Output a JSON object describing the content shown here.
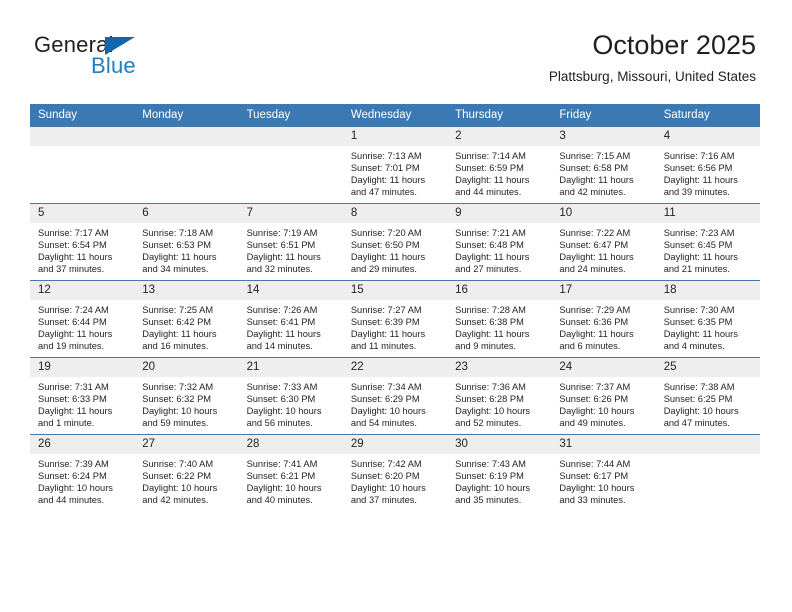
{
  "brand": {
    "name_top": "General",
    "name_bottom": "Blue",
    "color_dark": "#231f20",
    "color_blue": "#1f7fc4",
    "triangle_color": "#1266ae"
  },
  "header": {
    "title": "October 2025",
    "subtitle": "Plattsburg, Missouri, United States"
  },
  "theme": {
    "header_blue": "#3b79b5",
    "row_rule": "#4a77a8",
    "daynum_band": "#eeeeee",
    "text": "#231f20"
  },
  "labels": {
    "sunrise": "Sunrise:",
    "sunset": "Sunset:",
    "daylight": "Daylight:"
  },
  "weekdays": [
    "Sunday",
    "Monday",
    "Tuesday",
    "Wednesday",
    "Thursday",
    "Friday",
    "Saturday"
  ],
  "weeks": [
    [
      {
        "day": "",
        "blank": true,
        "sunrise": "",
        "sunset": "",
        "daylight": ""
      },
      {
        "day": "",
        "blank": true,
        "sunrise": "",
        "sunset": "",
        "daylight": ""
      },
      {
        "day": "",
        "blank": true,
        "sunrise": "",
        "sunset": "",
        "daylight": ""
      },
      {
        "day": "1",
        "blank": false,
        "sunrise": "Sunrise: 7:13 AM",
        "sunset": "Sunset: 7:01 PM",
        "daylight": "Daylight: 11 hours and 47 minutes."
      },
      {
        "day": "2",
        "blank": false,
        "sunrise": "Sunrise: 7:14 AM",
        "sunset": "Sunset: 6:59 PM",
        "daylight": "Daylight: 11 hours and 44 minutes."
      },
      {
        "day": "3",
        "blank": false,
        "sunrise": "Sunrise: 7:15 AM",
        "sunset": "Sunset: 6:58 PM",
        "daylight": "Daylight: 11 hours and 42 minutes."
      },
      {
        "day": "4",
        "blank": false,
        "sunrise": "Sunrise: 7:16 AM",
        "sunset": "Sunset: 6:56 PM",
        "daylight": "Daylight: 11 hours and 39 minutes."
      }
    ],
    [
      {
        "day": "5",
        "blank": false,
        "sunrise": "Sunrise: 7:17 AM",
        "sunset": "Sunset: 6:54 PM",
        "daylight": "Daylight: 11 hours and 37 minutes."
      },
      {
        "day": "6",
        "blank": false,
        "sunrise": "Sunrise: 7:18 AM",
        "sunset": "Sunset: 6:53 PM",
        "daylight": "Daylight: 11 hours and 34 minutes."
      },
      {
        "day": "7",
        "blank": false,
        "sunrise": "Sunrise: 7:19 AM",
        "sunset": "Sunset: 6:51 PM",
        "daylight": "Daylight: 11 hours and 32 minutes."
      },
      {
        "day": "8",
        "blank": false,
        "sunrise": "Sunrise: 7:20 AM",
        "sunset": "Sunset: 6:50 PM",
        "daylight": "Daylight: 11 hours and 29 minutes."
      },
      {
        "day": "9",
        "blank": false,
        "sunrise": "Sunrise: 7:21 AM",
        "sunset": "Sunset: 6:48 PM",
        "daylight": "Daylight: 11 hours and 27 minutes."
      },
      {
        "day": "10",
        "blank": false,
        "sunrise": "Sunrise: 7:22 AM",
        "sunset": "Sunset: 6:47 PM",
        "daylight": "Daylight: 11 hours and 24 minutes."
      },
      {
        "day": "11",
        "blank": false,
        "sunrise": "Sunrise: 7:23 AM",
        "sunset": "Sunset: 6:45 PM",
        "daylight": "Daylight: 11 hours and 21 minutes."
      }
    ],
    [
      {
        "day": "12",
        "blank": false,
        "sunrise": "Sunrise: 7:24 AM",
        "sunset": "Sunset: 6:44 PM",
        "daylight": "Daylight: 11 hours and 19 minutes."
      },
      {
        "day": "13",
        "blank": false,
        "sunrise": "Sunrise: 7:25 AM",
        "sunset": "Sunset: 6:42 PM",
        "daylight": "Daylight: 11 hours and 16 minutes."
      },
      {
        "day": "14",
        "blank": false,
        "sunrise": "Sunrise: 7:26 AM",
        "sunset": "Sunset: 6:41 PM",
        "daylight": "Daylight: 11 hours and 14 minutes."
      },
      {
        "day": "15",
        "blank": false,
        "sunrise": "Sunrise: 7:27 AM",
        "sunset": "Sunset: 6:39 PM",
        "daylight": "Daylight: 11 hours and 11 minutes."
      },
      {
        "day": "16",
        "blank": false,
        "sunrise": "Sunrise: 7:28 AM",
        "sunset": "Sunset: 6:38 PM",
        "daylight": "Daylight: 11 hours and 9 minutes."
      },
      {
        "day": "17",
        "blank": false,
        "sunrise": "Sunrise: 7:29 AM",
        "sunset": "Sunset: 6:36 PM",
        "daylight": "Daylight: 11 hours and 6 minutes."
      },
      {
        "day": "18",
        "blank": false,
        "sunrise": "Sunrise: 7:30 AM",
        "sunset": "Sunset: 6:35 PM",
        "daylight": "Daylight: 11 hours and 4 minutes."
      }
    ],
    [
      {
        "day": "19",
        "blank": false,
        "sunrise": "Sunrise: 7:31 AM",
        "sunset": "Sunset: 6:33 PM",
        "daylight": "Daylight: 11 hours and 1 minute."
      },
      {
        "day": "20",
        "blank": false,
        "sunrise": "Sunrise: 7:32 AM",
        "sunset": "Sunset: 6:32 PM",
        "daylight": "Daylight: 10 hours and 59 minutes."
      },
      {
        "day": "21",
        "blank": false,
        "sunrise": "Sunrise: 7:33 AM",
        "sunset": "Sunset: 6:30 PM",
        "daylight": "Daylight: 10 hours and 56 minutes."
      },
      {
        "day": "22",
        "blank": false,
        "sunrise": "Sunrise: 7:34 AM",
        "sunset": "Sunset: 6:29 PM",
        "daylight": "Daylight: 10 hours and 54 minutes."
      },
      {
        "day": "23",
        "blank": false,
        "sunrise": "Sunrise: 7:36 AM",
        "sunset": "Sunset: 6:28 PM",
        "daylight": "Daylight: 10 hours and 52 minutes."
      },
      {
        "day": "24",
        "blank": false,
        "sunrise": "Sunrise: 7:37 AM",
        "sunset": "Sunset: 6:26 PM",
        "daylight": "Daylight: 10 hours and 49 minutes."
      },
      {
        "day": "25",
        "blank": false,
        "sunrise": "Sunrise: 7:38 AM",
        "sunset": "Sunset: 6:25 PM",
        "daylight": "Daylight: 10 hours and 47 minutes."
      }
    ],
    [
      {
        "day": "26",
        "blank": false,
        "sunrise": "Sunrise: 7:39 AM",
        "sunset": "Sunset: 6:24 PM",
        "daylight": "Daylight: 10 hours and 44 minutes."
      },
      {
        "day": "27",
        "blank": false,
        "sunrise": "Sunrise: 7:40 AM",
        "sunset": "Sunset: 6:22 PM",
        "daylight": "Daylight: 10 hours and 42 minutes."
      },
      {
        "day": "28",
        "blank": false,
        "sunrise": "Sunrise: 7:41 AM",
        "sunset": "Sunset: 6:21 PM",
        "daylight": "Daylight: 10 hours and 40 minutes."
      },
      {
        "day": "29",
        "blank": false,
        "sunrise": "Sunrise: 7:42 AM",
        "sunset": "Sunset: 6:20 PM",
        "daylight": "Daylight: 10 hours and 37 minutes."
      },
      {
        "day": "30",
        "blank": false,
        "sunrise": "Sunrise: 7:43 AM",
        "sunset": "Sunset: 6:19 PM",
        "daylight": "Daylight: 10 hours and 35 minutes."
      },
      {
        "day": "31",
        "blank": false,
        "sunrise": "Sunrise: 7:44 AM",
        "sunset": "Sunset: 6:17 PM",
        "daylight": "Daylight: 10 hours and 33 minutes."
      },
      {
        "day": "",
        "blank": true,
        "sunrise": "",
        "sunset": "",
        "daylight": ""
      }
    ]
  ]
}
